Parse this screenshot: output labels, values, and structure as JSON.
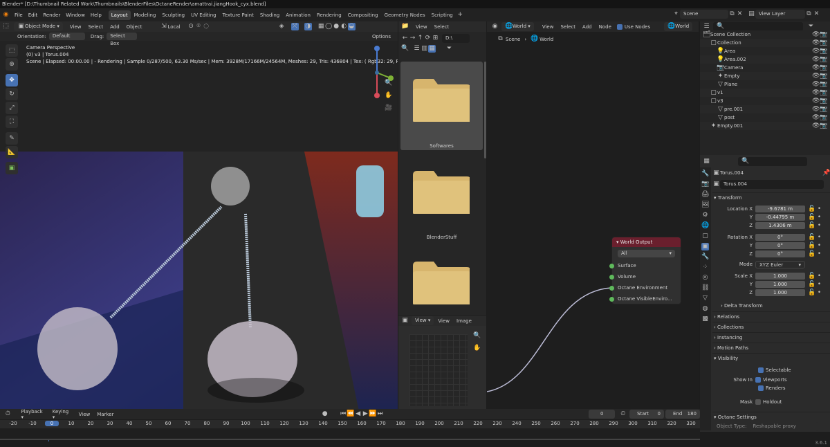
{
  "title_bar": {
    "text": "Blender* [D:\\Thumbnail Related Work\\Thumbnails\\BlenderFiles\\OctaneRender\\amattrai.jiangHook_cyx.blend]"
  },
  "menu": {
    "items": [
      "File",
      "Edit",
      "Render",
      "Window",
      "Help"
    ]
  },
  "workspaces": [
    "Layout",
    "Modeling",
    "Sculpting",
    "UV Editing",
    "Texture Paint",
    "Shading",
    "Animation",
    "Rendering",
    "Compositing",
    "Geometry Nodes",
    "Scripting"
  ],
  "scene": {
    "label": "Scene",
    "view_layer": "View Layer"
  },
  "viewport": {
    "mode": "Object Mode",
    "menus": [
      "View",
      "Select",
      "Add",
      "Object"
    ],
    "transform": "Local",
    "orientation_label": "Orientation:",
    "orientation": "Default",
    "drag_label": "Drag:",
    "drag": "Select Box",
    "options": "Options",
    "overlay": {
      "camera": "Camera Perspective",
      "object": "(0) v3 | Torus.004",
      "stats": "Scene | Elapsed: 00:00.00 |  - Rendering | Sample 0/287/500, 63.30 Ms/sec | Mem: 3928M/17166M/24564M, Meshes: 29, Tris: 436804 | Tex: ( Rgb32: 29, Rgb64: 0, grey8: 6 )"
    }
  },
  "file_browser": {
    "menus": [
      "View",
      "Select"
    ],
    "path": "D:\\",
    "folders": [
      "Softwares",
      "BlenderStuff",
      ""
    ]
  },
  "image_editor": {
    "menus": [
      "View",
      "View",
      "Image"
    ]
  },
  "node_editor": {
    "menus": [
      "View",
      "Select",
      "Add",
      "Node"
    ],
    "use_nodes": "Use Nodes",
    "world_type": "World",
    "world": "World",
    "breadcrumb": [
      "Scene",
      "World"
    ],
    "node": {
      "title": "World Output",
      "target": "All",
      "sockets": [
        "Surface",
        "Volume",
        "Octane Environment",
        "Octane VisibleEnviro..."
      ]
    }
  },
  "outliner": {
    "search": "",
    "items": [
      {
        "name": "Scene Collection",
        "indent": 0
      },
      {
        "name": "Collection",
        "indent": 1
      },
      {
        "name": "Area",
        "indent": 2
      },
      {
        "name": "Area.002",
        "indent": 2
      },
      {
        "name": "Camera",
        "indent": 2
      },
      {
        "name": "Empty",
        "indent": 2
      },
      {
        "name": "Plane",
        "indent": 2
      },
      {
        "name": "v1",
        "indent": 1
      },
      {
        "name": "v3",
        "indent": 1
      },
      {
        "name": "pre.001",
        "indent": 2
      },
      {
        "name": "post",
        "indent": 2
      },
      {
        "name": "Empty.001",
        "indent": 1
      }
    ]
  },
  "properties": {
    "object": "Torus.004",
    "object_field": "Torus.004",
    "transform_label": "Transform",
    "location": {
      "labels": [
        "Location X",
        "Y",
        "Z"
      ],
      "values": [
        "-9.6781 m",
        "-0.44795 m",
        "1.4306 m"
      ]
    },
    "rotation": {
      "labels": [
        "Rotation X",
        "Y",
        "Z"
      ],
      "values": [
        "0°",
        "0°",
        "0°"
      ]
    },
    "mode_label": "Mode",
    "mode": "XYZ Euler",
    "scale": {
      "labels": [
        "Scale X",
        "Y",
        "Z"
      ],
      "values": [
        "1.000",
        "1.000",
        "1.000"
      ]
    },
    "sections": [
      "Delta Transform",
      "Relations",
      "Collections",
      "Instancing",
      "Motion Paths",
      "Visibility"
    ],
    "visibility": {
      "selectable": "Selectable",
      "show_in": "Show In",
      "viewports": "Viewports",
      "renders": "Renders",
      "mask": "Mask",
      "holdout": "Holdout"
    },
    "octane_settings": "Octane Settings",
    "object_type_label": "Object Type:",
    "object_type": "Reshapable proxy"
  },
  "timeline": {
    "menus": [
      "Playback",
      "Keying",
      "View",
      "Marker"
    ],
    "current_frame": "0",
    "start_label": "Start",
    "start": "0",
    "end_label": "End",
    "end": "180",
    "ticks": [
      "-20",
      "-10",
      "0",
      "10",
      "20",
      "30",
      "40",
      "50",
      "60",
      "70",
      "80",
      "90",
      "100",
      "110",
      "120",
      "130",
      "140",
      "150",
      "160",
      "170",
      "180",
      "190",
      "200",
      "210",
      "220",
      "230",
      "240",
      "250",
      "260",
      "270",
      "280",
      "290",
      "300",
      "310",
      "320",
      "330"
    ],
    "version": "3.6.1"
  },
  "colors": {
    "accent": "#4772b3",
    "folder": "#d7b56d",
    "node_header": "#6a1f2d",
    "socket": "#5fba5c"
  }
}
